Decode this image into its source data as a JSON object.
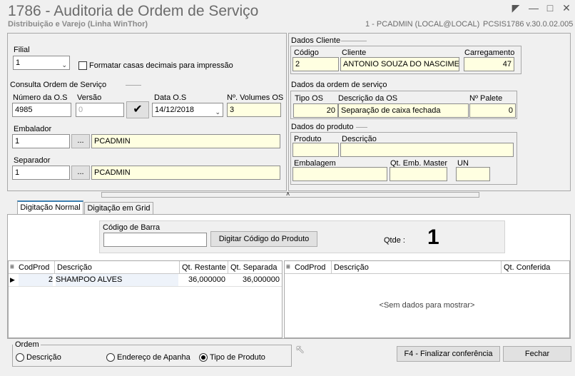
{
  "window": {
    "title": "1786 - Auditoria de Ordem de Serviço",
    "subtitle": "Distribuição e Varejo (Linha WinThor)",
    "user": "1 - PCADMIN (LOCAL@LOCAL)",
    "version": "PCSIS1786  v.30.0.02.005"
  },
  "filial": {
    "label": "Filial",
    "value": "1"
  },
  "format_decimals": {
    "label": "Formatar casas decimais para impressão",
    "checked": false
  },
  "consulta": {
    "title": "Consulta Ordem de Serviço",
    "numero_label": "Número da  O.S",
    "numero_value": "4985",
    "versao_label": "Versão",
    "versao_value": "0",
    "data_label": "Data O.S",
    "data_value": "14/12/2018",
    "volumes_label": "Nº. Volumes OS",
    "volumes_value": "3"
  },
  "embalador": {
    "label": "Embalador",
    "code": "1",
    "browse": "...",
    "name": "PCADMIN"
  },
  "separador": {
    "label": "Separador",
    "code": "1",
    "browse": "...",
    "name": "PCADMIN"
  },
  "dados_cliente": {
    "title": "Dados Cliente",
    "codigo_label": "Código",
    "codigo_value": "2",
    "cliente_label": "Cliente",
    "cliente_value": "ANTONIO SOUZA DO NASCIMENT",
    "carregamento_label": "Carregamento",
    "carregamento_value": "47"
  },
  "dados_ordem": {
    "title": "Dados da ordem de serviço",
    "tipo_label": "Tipo OS",
    "tipo_value": "20",
    "descricao_label": "Descrição da OS",
    "descricao_value": "Separação de caixa fechada",
    "palete_label": "Nº Palete",
    "palete_value": "0"
  },
  "dados_produto": {
    "title": "Dados do produto",
    "produto_label": "Produto",
    "produto_value": "",
    "descricao_label": "Descrição",
    "descricao_value": "",
    "embalagem_label": "Embalagem",
    "embalagem_value": "",
    "qt_emb_label": "Qt. Emb. Master",
    "qt_emb_value": "",
    "un_label": "UN",
    "un_value": ""
  },
  "tabs": [
    {
      "label": "Digitação Normal",
      "active": true
    },
    {
      "label": "Digitação em Grid",
      "active": false
    }
  ],
  "barcode": {
    "label": "Código de Barra",
    "value": "",
    "button": "Digitar Código do Produto",
    "qtde_label": "Qtde :",
    "qtde_value": "1"
  },
  "grid_left": {
    "columns": [
      "CodProd",
      "Descrição",
      "Qt. Restante",
      "Qt. Separada"
    ],
    "rows": [
      {
        "codprod": "2",
        "descricao": "SHAMPOO ALVES",
        "restante": "36,000000",
        "separada": "36,000000"
      }
    ]
  },
  "grid_right": {
    "columns": [
      "CodProd",
      "Descrição",
      "Qt. Conferida"
    ],
    "empty_text": "<Sem dados para mostrar>"
  },
  "ordem": {
    "title": "Ordem",
    "options": [
      {
        "label": "Descrição",
        "checked": false
      },
      {
        "label": "Endereço de Apanha",
        "checked": false
      },
      {
        "label": "Tipo de Produto",
        "checked": true
      }
    ]
  },
  "actions": {
    "finalizar": "F4 - Finalizar conferência",
    "fechar": "Fechar"
  },
  "colors": {
    "field_yellow": "#ffffe1",
    "tab_accent": "#3c7fb1"
  }
}
